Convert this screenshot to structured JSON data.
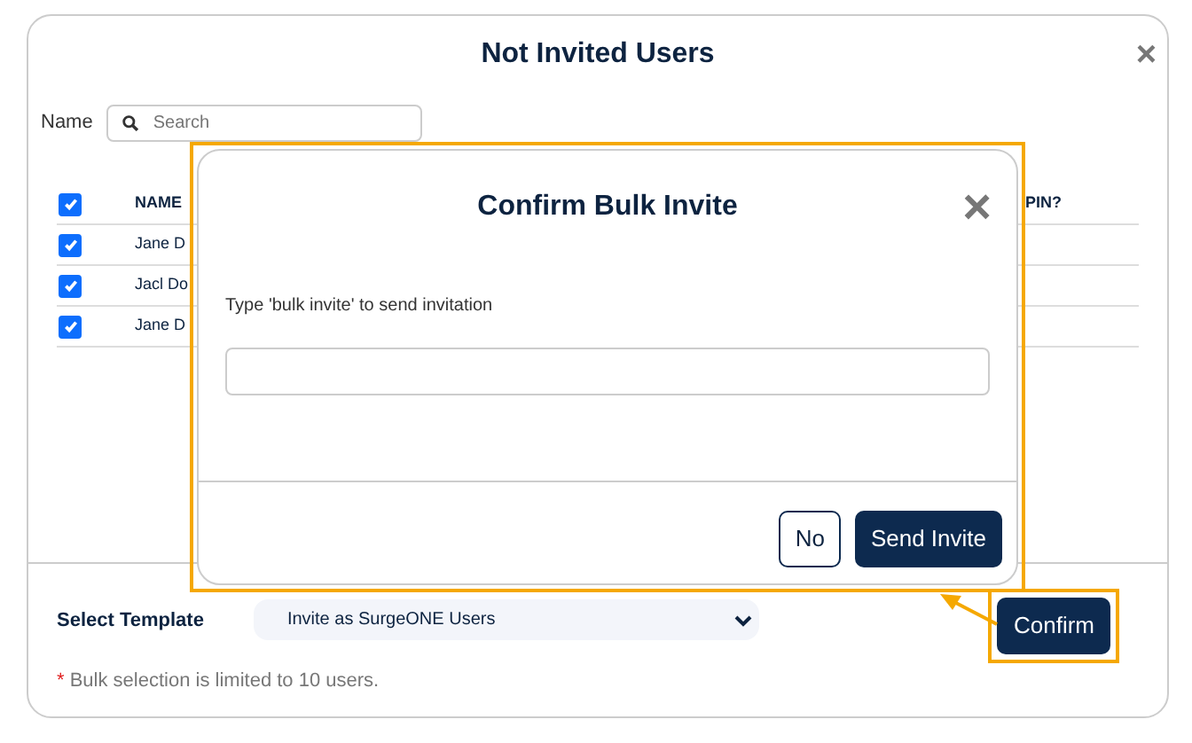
{
  "modal": {
    "title": "Not Invited Users",
    "close": "×",
    "search": {
      "label": "Name",
      "placeholder": "Search"
    },
    "table": {
      "all_checked": true,
      "columns": [
        "NAME",
        "PIN?"
      ],
      "rows": [
        {
          "checked": true,
          "name": "Jane D"
        },
        {
          "checked": true,
          "name": "Jacl Do"
        },
        {
          "checked": true,
          "name": "Jane D"
        }
      ]
    },
    "template": {
      "label": "Select Template",
      "value": "Invite as SurgeONE Users"
    },
    "note": {
      "mark": "*",
      "text": "Bulk selection is limited to 10 users."
    },
    "confirm": "Confirm"
  },
  "dialog": {
    "title": "Confirm Bulk Invite",
    "close": "×",
    "prompt": "Type 'bulk invite' to send invitation",
    "buttons": [
      {
        "kind": "secondary",
        "label": "No"
      },
      {
        "kind": "primary",
        "label": "Send Invite"
      }
    ]
  }
}
